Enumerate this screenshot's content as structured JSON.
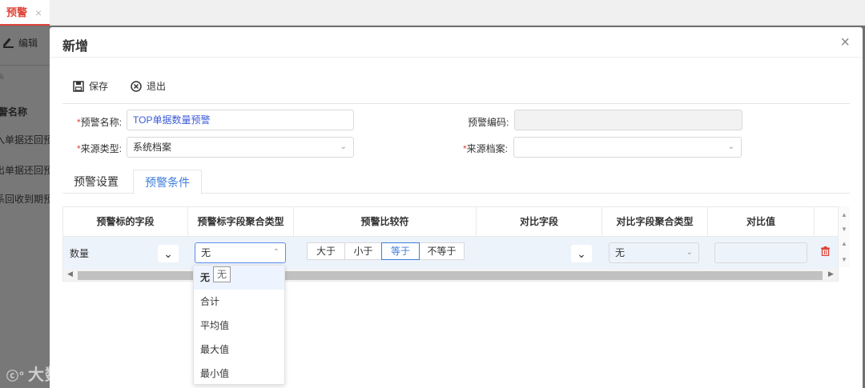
{
  "tabbar": {
    "active_tab": "预警",
    "close_glyph": "×"
  },
  "background": {
    "edit_label": "编辑",
    "filter_hint": "k",
    "column_header": "警名称",
    "rows": [
      "入单据还回预",
      "出单据还回预",
      "系回收到期预"
    ]
  },
  "watermark": {
    "text": "大数跨境",
    "logo": "ⓒ°"
  },
  "modal": {
    "title": "新增",
    "close_glyph": "×",
    "toolbar": {
      "save": "保存",
      "exit": "退出"
    },
    "form": {
      "name_label": "预警名称:",
      "name_value": "TOP单据数量预警",
      "code_label": "预警编码:",
      "code_value": "",
      "source_type_label": "来源类型:",
      "source_type_value": "系统档案",
      "source_archive_label": "来源档案:",
      "source_archive_value": "",
      "required_mark": "*"
    },
    "tabs": [
      "预警设置",
      "预警条件"
    ],
    "active_tab_index": 1,
    "grid": {
      "columns": [
        "预警标的字段",
        "预警标字段聚合类型",
        "预警比较符",
        "对比字段",
        "对比字段聚合类型",
        "对比值"
      ],
      "row": {
        "field": "数量",
        "aggregate": "无",
        "comparators": [
          "大于",
          "小于",
          "等于",
          "不等于"
        ],
        "selected_comparator": "等于",
        "compare_field": "",
        "compare_aggregate": "无",
        "compare_value": ""
      }
    },
    "dropdown": {
      "options": [
        "无",
        "合计",
        "平均值",
        "最大值",
        "最小值"
      ],
      "selected": "无",
      "tooltip": "无"
    }
  },
  "colors": {
    "accent": "#3d7ddb",
    "danger": "#e0443a",
    "text_blue": "#3d5bd9"
  }
}
